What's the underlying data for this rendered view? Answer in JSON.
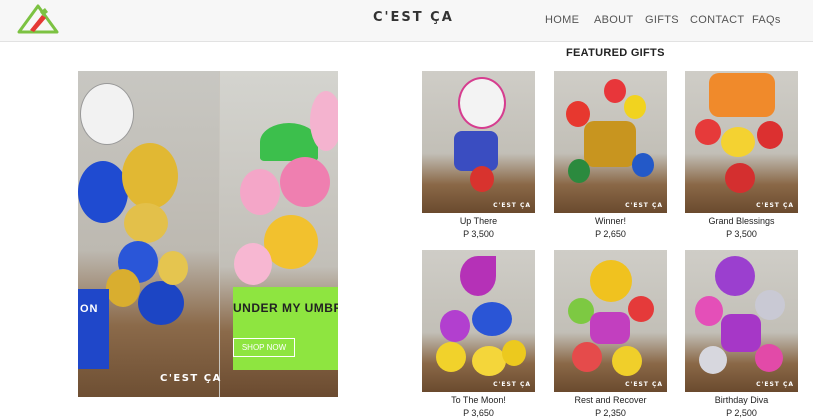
{
  "header": {
    "brand": "C'EST ÇA",
    "nav": [
      "HOME",
      "ABOUT",
      "GIFTS",
      "CONTACT",
      "FAQs"
    ]
  },
  "slider": {
    "slide1_text": "ON",
    "slide2_title": "UNDER MY UMBR",
    "shop_button": "SHOP NOW",
    "watermark": "C'EST ÇA",
    "accent_blue": "#1f47c9",
    "accent_green": "#8ee540"
  },
  "featured": {
    "title": "FEATURED GIFTS",
    "watermark": "C'EST ÇA",
    "products": [
      {
        "name": "Up There",
        "price": "P 3,500"
      },
      {
        "name": "Winner!",
        "price": "P 2,650"
      },
      {
        "name": "Grand Blessings",
        "price": "P 3,500"
      },
      {
        "name": "To The Moon!",
        "price": "P 3,650"
      },
      {
        "name": "Rest and Recover",
        "price": "P 2,350"
      },
      {
        "name": "Birthday Diva",
        "price": "P 2,500"
      }
    ]
  }
}
